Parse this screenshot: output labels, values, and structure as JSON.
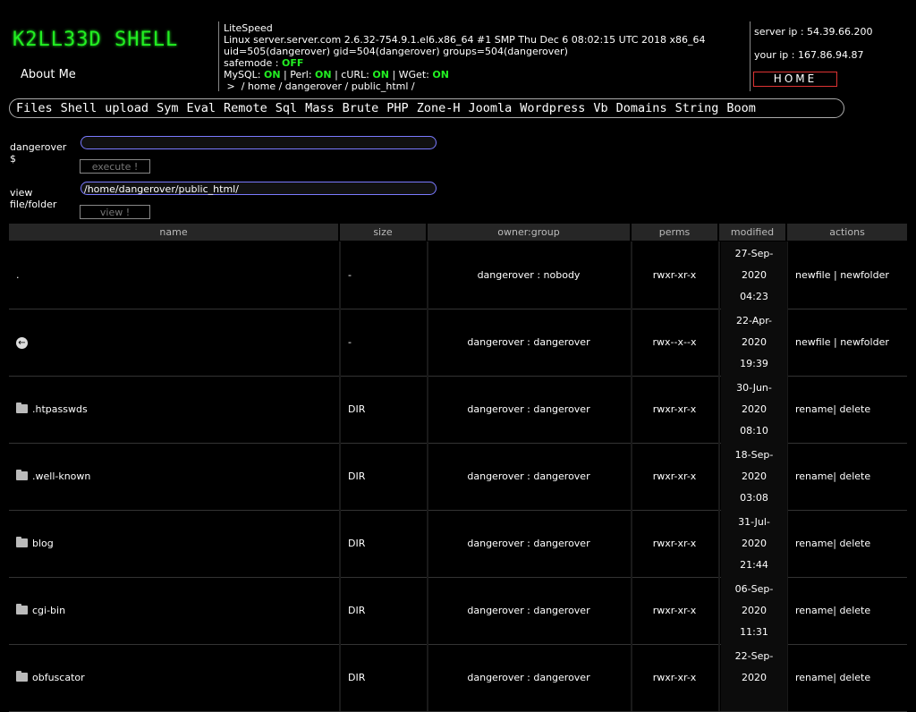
{
  "header": {
    "logo": "K2LL33D SHELL",
    "about": "About Me",
    "server_software": "LiteSpeed",
    "uname": "Linux server.server.com 2.6.32-754.9.1.el6.x86_64 #1 SMP Thu Dec 6 08:02:15 UTC 2018 x86_64",
    "uid_line": "uid=505(dangerover) gid=504(dangerover) groups=504(dangerover)",
    "safemode_label": "safemode : ",
    "safemode_value": "OFF",
    "mysql_label": "MySQL: ",
    "mysql_value": "ON",
    "perl_label": " | Perl: ",
    "perl_value": "ON",
    "curl_label": " | cURL: ",
    "curl_value": "ON",
    "wget_label": " | WGet: ",
    "wget_value": "ON",
    "path": " >  / home / dangerover / public_html /",
    "server_ip": "server ip : 54.39.66.200",
    "your_ip": "your ip : 167.86.94.87",
    "home_button": "HOME",
    "accent_color": "#22ee22"
  },
  "menu": [
    "Files",
    "Shell",
    "upload",
    "Sym",
    "Eval",
    "Remote",
    "Sql",
    "Mass",
    "Brute",
    "PHP",
    "Zone-H",
    "Joomla",
    "Wordpress",
    "Vb",
    "Domains",
    "String",
    "Boom"
  ],
  "forms": {
    "cmd_label_1": "dangerover",
    "cmd_label_2": "$",
    "cmd_value": "",
    "execute_button": "execute !",
    "view_label_1": "view",
    "view_label_2": "file/folder",
    "view_value": "/home/dangerover/public_html/",
    "view_button": "view !"
  },
  "table": {
    "headers": [
      "name",
      "size",
      "owner:group",
      "perms",
      "modified",
      "actions"
    ],
    "rows": [
      {
        "icon": "none",
        "name": ".",
        "size": "-",
        "owner": "dangerover",
        "group": "nobody",
        "perms": "rwxr-xr-x",
        "date": "27-Sep-",
        "year": "2020",
        "time": "04:23",
        "action1": "newfile",
        "action2": "newfolder"
      },
      {
        "icon": "back-arrow-icon",
        "name": "",
        "size": "-",
        "owner": "dangerover",
        "group": "dangerover",
        "perms": "rwx--x--x",
        "date": "22-Apr-",
        "year": "2020",
        "time": "19:39",
        "action1": "newfile",
        "action2": "newfolder"
      },
      {
        "icon": "folder-icon",
        "name": ".htpasswds",
        "size": "DIR",
        "owner": "dangerover",
        "group": "dangerover",
        "perms": "rwxr-xr-x",
        "date": "30-Jun-",
        "year": "2020",
        "time": "08:10",
        "action1": "rename|",
        "action2": "delete"
      },
      {
        "icon": "folder-icon",
        "name": ".well-known",
        "size": "DIR",
        "owner": "dangerover",
        "group": "dangerover",
        "perms": "rwxr-xr-x",
        "date": "18-Sep-",
        "year": "2020",
        "time": "03:08",
        "action1": "rename|",
        "action2": "delete"
      },
      {
        "icon": "folder-icon",
        "name": "blog",
        "size": "DIR",
        "owner": "dangerover",
        "group": "dangerover",
        "perms": "rwxr-xr-x",
        "date": "31-Jul-",
        "year": "2020",
        "time": "21:44",
        "action1": "rename|",
        "action2": "delete"
      },
      {
        "icon": "folder-icon",
        "name": "cgi-bin",
        "size": "DIR",
        "owner": "dangerover",
        "group": "dangerover",
        "perms": "rwxr-xr-x",
        "date": "06-Sep-",
        "year": "2020",
        "time": "11:31",
        "action1": "rename|",
        "action2": "delete"
      },
      {
        "icon": "folder-icon",
        "name": "obfuscator",
        "size": "DIR",
        "owner": "dangerover",
        "group": "dangerover",
        "perms": "rwxr-xr-x",
        "date": "22-Sep-",
        "year": "2020",
        "time": "",
        "action1": "rename|",
        "action2": "delete"
      }
    ]
  }
}
